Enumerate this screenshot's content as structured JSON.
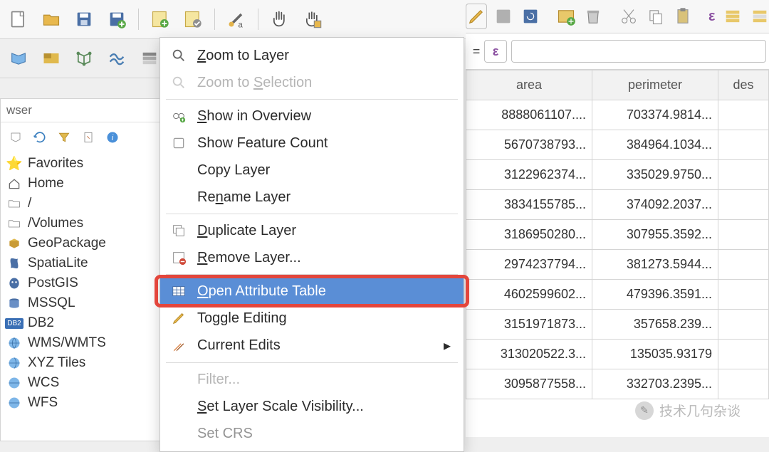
{
  "toolbar_icons": [
    "new-project",
    "open-project",
    "save",
    "save-as",
    "new-layout",
    "layout-manager",
    "style-manager",
    "zoom-full",
    "zoom-selection",
    "pan",
    "pan-selection",
    "edit-pencil",
    "refresh",
    "save-edits",
    "delete",
    "layout",
    "select",
    "cut",
    "copy",
    "paste",
    "epsilon",
    "layers",
    "expression",
    "filter2",
    "conditional"
  ],
  "browser": {
    "title": "wser",
    "items": [
      {
        "icon": "star",
        "label": "Favorites"
      },
      {
        "icon": "home",
        "label": "Home"
      },
      {
        "icon": "folder",
        "label": "/"
      },
      {
        "icon": "folder",
        "label": "/Volumes"
      },
      {
        "icon": "geopackage",
        "label": "GeoPackage"
      },
      {
        "icon": "spatialite",
        "label": "SpatiaLite"
      },
      {
        "icon": "postgis",
        "label": "PostGIS"
      },
      {
        "icon": "mssql",
        "label": "MSSQL"
      },
      {
        "icon": "db2",
        "label": "DB2"
      },
      {
        "icon": "wms",
        "label": "WMS/WMTS"
      },
      {
        "icon": "xyz",
        "label": "XYZ Tiles"
      },
      {
        "icon": "wcs",
        "label": "WCS"
      },
      {
        "icon": "wfs",
        "label": "WFS"
      }
    ]
  },
  "menu": [
    {
      "icon": "zoom",
      "label": "Zoom to Layer",
      "u": 0
    },
    {
      "icon": "zoom",
      "label": "Zoom to Selection",
      "u": 8,
      "disabled": true
    },
    {
      "sep": true
    },
    {
      "icon": "glasses",
      "label": "Show in Overview",
      "u": 0
    },
    {
      "icon": "checkbox",
      "label": "Show Feature Count"
    },
    {
      "icon": "",
      "label": "Copy Layer"
    },
    {
      "icon": "",
      "label": "Rename Layer",
      "u": 2
    },
    {
      "sep": true
    },
    {
      "icon": "duplicate",
      "label": "Duplicate Layer",
      "u": 0
    },
    {
      "icon": "remove",
      "label": "Remove Layer...",
      "u": 0
    },
    {
      "sep": true
    },
    {
      "icon": "table",
      "label": "Open Attribute Table",
      "u": 0,
      "highlight": true,
      "boxed": true
    },
    {
      "icon": "pencil",
      "label": "Toggle Editing"
    },
    {
      "icon": "edits",
      "label": "Current Edits",
      "sub": true
    },
    {
      "sep": true
    },
    {
      "icon": "",
      "label": "Filter...",
      "disabled": true
    },
    {
      "icon": "",
      "label": "Set Layer Scale Visibility...",
      "u": 0
    },
    {
      "icon": "",
      "label": "Set CRS",
      "partial": true
    }
  ],
  "table": {
    "filter_placeholder": "",
    "headers": [
      "area",
      "perimeter",
      "des"
    ],
    "rows": [
      {
        "area": "8888061107....",
        "per": "703374.9814..."
      },
      {
        "area": "5670738793...",
        "per": "384964.1034..."
      },
      {
        "area": "3122962374...",
        "per": "335029.9750..."
      },
      {
        "area": "3834155785...",
        "per": "374092.2037..."
      },
      {
        "area": "3186950280...",
        "per": "307955.3592..."
      },
      {
        "area": "2974237794...",
        "per": "381273.5944..."
      },
      {
        "area": "4602599602...",
        "per": "479396.3591..."
      },
      {
        "area": "3151971873...",
        "per": "357658.239..."
      },
      {
        "area": "313020522.3...",
        "per": "135035.93179"
      },
      {
        "area": "3095877558...",
        "per": "332703.2395..."
      }
    ]
  },
  "watermark": "技术几句杂谈"
}
